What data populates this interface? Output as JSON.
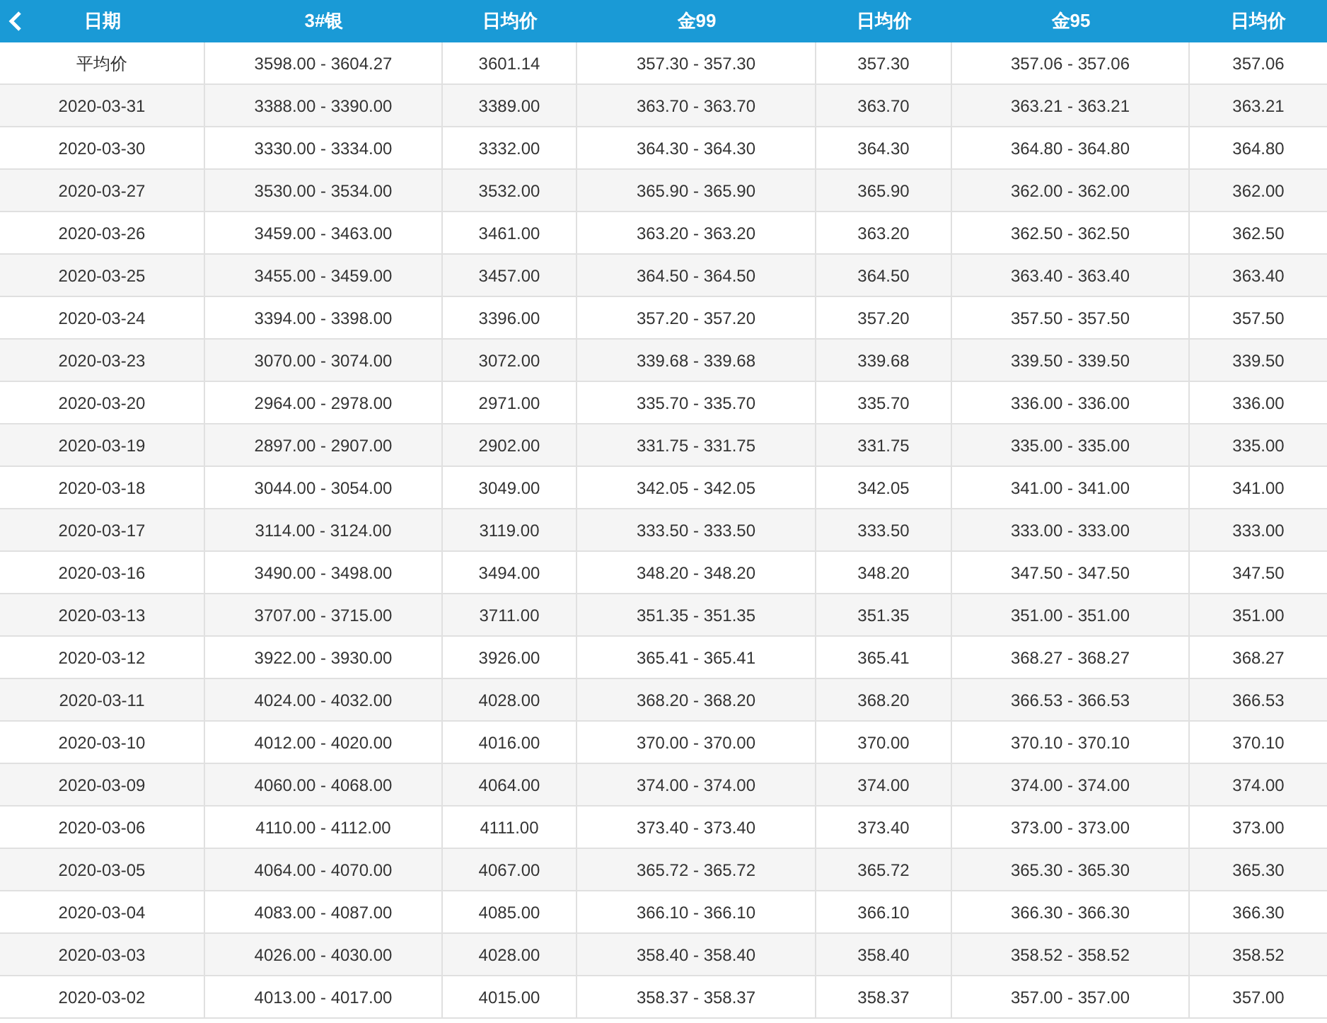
{
  "table": {
    "columns": [
      "日期",
      "3#银",
      "日均价",
      "金99",
      "日均价",
      "金95",
      "日均价"
    ],
    "rows": [
      [
        "平均价",
        "3598.00 - 3604.27",
        "3601.14",
        "357.30 - 357.30",
        "357.30",
        "357.06 - 357.06",
        "357.06"
      ],
      [
        "2020-03-31",
        "3388.00 - 3390.00",
        "3389.00",
        "363.70 - 363.70",
        "363.70",
        "363.21 - 363.21",
        "363.21"
      ],
      [
        "2020-03-30",
        "3330.00 - 3334.00",
        "3332.00",
        "364.30 - 364.30",
        "364.30",
        "364.80 - 364.80",
        "364.80"
      ],
      [
        "2020-03-27",
        "3530.00 - 3534.00",
        "3532.00",
        "365.90 - 365.90",
        "365.90",
        "362.00 - 362.00",
        "362.00"
      ],
      [
        "2020-03-26",
        "3459.00 - 3463.00",
        "3461.00",
        "363.20 - 363.20",
        "363.20",
        "362.50 - 362.50",
        "362.50"
      ],
      [
        "2020-03-25",
        "3455.00 - 3459.00",
        "3457.00",
        "364.50 - 364.50",
        "364.50",
        "363.40 - 363.40",
        "363.40"
      ],
      [
        "2020-03-24",
        "3394.00 - 3398.00",
        "3396.00",
        "357.20 - 357.20",
        "357.20",
        "357.50 - 357.50",
        "357.50"
      ],
      [
        "2020-03-23",
        "3070.00 - 3074.00",
        "3072.00",
        "339.68 - 339.68",
        "339.68",
        "339.50 - 339.50",
        "339.50"
      ],
      [
        "2020-03-20",
        "2964.00 - 2978.00",
        "2971.00",
        "335.70 - 335.70",
        "335.70",
        "336.00 - 336.00",
        "336.00"
      ],
      [
        "2020-03-19",
        "2897.00 - 2907.00",
        "2902.00",
        "331.75 - 331.75",
        "331.75",
        "335.00 - 335.00",
        "335.00"
      ],
      [
        "2020-03-18",
        "3044.00 - 3054.00",
        "3049.00",
        "342.05 - 342.05",
        "342.05",
        "341.00 - 341.00",
        "341.00"
      ],
      [
        "2020-03-17",
        "3114.00 - 3124.00",
        "3119.00",
        "333.50 - 333.50",
        "333.50",
        "333.00 - 333.00",
        "333.00"
      ],
      [
        "2020-03-16",
        "3490.00 - 3498.00",
        "3494.00",
        "348.20 - 348.20",
        "348.20",
        "347.50 - 347.50",
        "347.50"
      ],
      [
        "2020-03-13",
        "3707.00 - 3715.00",
        "3711.00",
        "351.35 - 351.35",
        "351.35",
        "351.00 - 351.00",
        "351.00"
      ],
      [
        "2020-03-12",
        "3922.00 - 3930.00",
        "3926.00",
        "365.41 - 365.41",
        "365.41",
        "368.27 - 368.27",
        "368.27"
      ],
      [
        "2020-03-11",
        "4024.00 - 4032.00",
        "4028.00",
        "368.20 - 368.20",
        "368.20",
        "366.53 - 366.53",
        "366.53"
      ],
      [
        "2020-03-10",
        "4012.00 - 4020.00",
        "4016.00",
        "370.00 - 370.00",
        "370.00",
        "370.10 - 370.10",
        "370.10"
      ],
      [
        "2020-03-09",
        "4060.00 - 4068.00",
        "4064.00",
        "374.00 - 374.00",
        "374.00",
        "374.00 - 374.00",
        "374.00"
      ],
      [
        "2020-03-06",
        "4110.00 - 4112.00",
        "4111.00",
        "373.40 - 373.40",
        "373.40",
        "373.00 - 373.00",
        "373.00"
      ],
      [
        "2020-03-05",
        "4064.00 - 4070.00",
        "4067.00",
        "365.72 - 365.72",
        "365.72",
        "365.30 - 365.30",
        "365.30"
      ],
      [
        "2020-03-04",
        "4083.00 - 4087.00",
        "4085.00",
        "366.10 - 366.10",
        "366.10",
        "366.30 - 366.30",
        "366.30"
      ],
      [
        "2020-03-03",
        "4026.00 - 4030.00",
        "4028.00",
        "358.40 - 358.40",
        "358.40",
        "358.52 - 358.52",
        "358.52"
      ],
      [
        "2020-03-02",
        "4013.00 - 4017.00",
        "4015.00",
        "358.37 - 358.37",
        "358.37",
        "357.00 - 357.00",
        "357.00"
      ]
    ]
  }
}
